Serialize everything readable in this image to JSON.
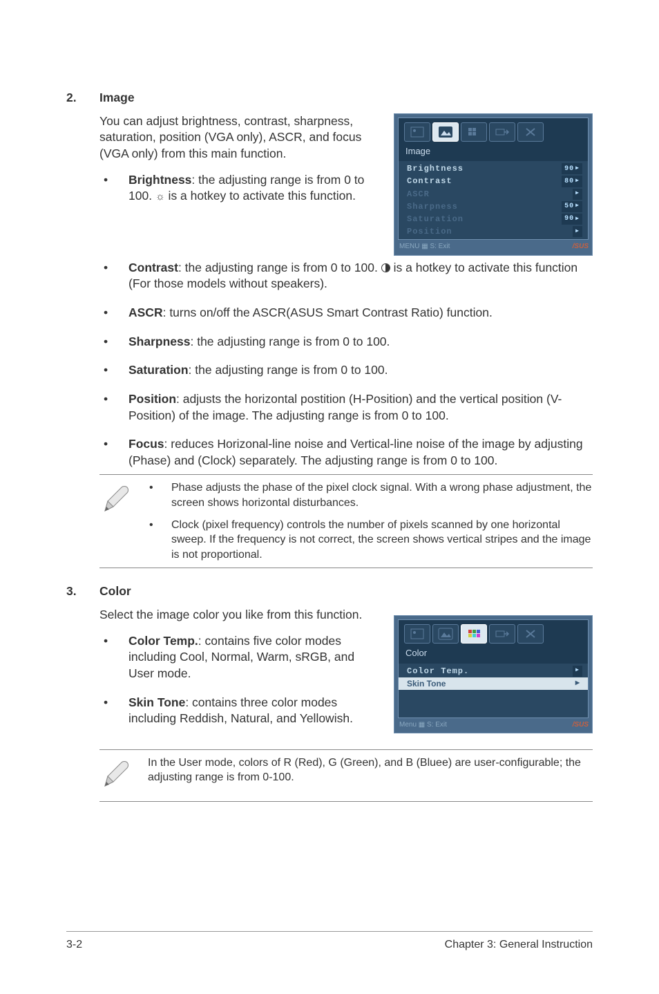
{
  "section2": {
    "num": "2.",
    "title": "Image",
    "intro": "You can adjust brightness, contrast, sharpness, saturation, position (VGA only), ASCR, and focus (VGA only) from this main function.",
    "bullets": [
      {
        "label": "Brightness",
        "textA": ": the adjusting range is from 0 to 100. ",
        "textB": " is a hotkey to activate this function."
      },
      {
        "label": "Contrast",
        "textA": ": the adjusting range is from 0 to 100. ",
        "textB": " is a hotkey to activate this function (For those models without speakers)."
      },
      {
        "label": "ASCR",
        "text": ": turns on/off the ASCR(ASUS Smart Contrast Ratio) function."
      },
      {
        "label": "Sharpness",
        "text": ": the adjusting range is from 0 to 100."
      },
      {
        "label": "Saturation",
        "text": ": the adjusting range is from 0 to 100."
      },
      {
        "label": "Position",
        "text": ": adjusts the horizontal postition (H-Position) and the vertical position (V-Position) of the image. The adjusting range is from 0 to 100."
      },
      {
        "label": "Focus",
        "text": ": reduces Horizonal-line noise and Vertical-line noise of the image by adjusting (Phase) and (Clock) separately. The adjusting range is from 0 to 100."
      }
    ]
  },
  "note1": {
    "items": [
      "Phase adjusts the phase of the pixel clock signal. With a wrong phase adjustment, the screen shows  horizontal disturbances.",
      "Clock (pixel frequency) controls the number of pixels scanned by one horizontal sweep. If the frequency is not correct, the screen shows vertical stripes and the image is not proportional."
    ]
  },
  "section3": {
    "num": "3.",
    "title": "Color",
    "intro": "Select the image color you like from this function.",
    "bullets": [
      {
        "label": "Color Temp.",
        "text": ": contains five color modes including Cool, Normal, Warm, sRGB, and User mode."
      },
      {
        "label": "Skin Tone",
        "text": ": contains three color modes including Reddish, Natural, and Yellowish."
      }
    ]
  },
  "note2": {
    "text": "In the User mode, colors of R (Red), G (Green), and B (Bluee) are user-configurable; the adjusting range is from 0-100."
  },
  "osd1": {
    "title": "Image",
    "rows": [
      {
        "label": "Brightness",
        "val": "90",
        "sel": true
      },
      {
        "label": "Contrast",
        "val": "80",
        "sel": true
      },
      {
        "label": "ASCR",
        "val": ""
      },
      {
        "label": "Sharpness",
        "val": "50"
      },
      {
        "label": "Saturation",
        "val": "90"
      },
      {
        "label": "Position",
        "val": ""
      }
    ],
    "footer_left": "MENU ▦  S: Exit",
    "brand": "/SUS"
  },
  "osd2": {
    "title": "Color",
    "rows": [
      {
        "label": "Color Temp.",
        "sel": true
      },
      {
        "label": "Skin Tone",
        "hl": true
      }
    ],
    "footer_left": "Menu ▦   S: Exit",
    "brand": "/SUS"
  },
  "footer": {
    "left": "3-2",
    "right": "Chapter 3: General Instruction"
  }
}
